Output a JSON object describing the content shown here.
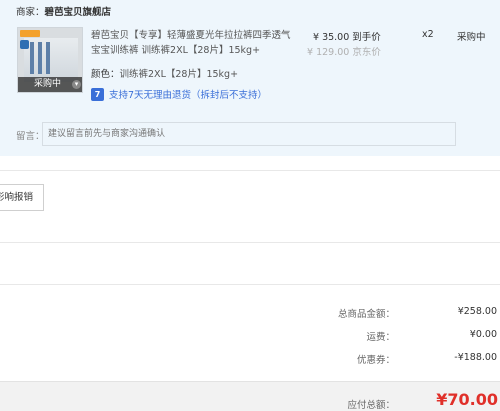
{
  "merchant": {
    "label": "商家：",
    "name": "碧芭宝贝旗舰店"
  },
  "product": {
    "title": "碧芭宝贝【专享】轻薄盛夏光年拉拉裤四季透气宝宝训练裤 训练裤2XL【28片】15kg+",
    "price": "¥ 35.00 到手价",
    "original_price": "¥ 129.00 京东价",
    "quantity": "x2",
    "status": "采购中",
    "image_overlay_label": "采购中",
    "spec_key": "颜色：",
    "spec_value": "训练裤2XL【28片】15kg+",
    "return_policy": "支持7天无理由退货（拆封后不支持）",
    "return_icon": "7"
  },
  "message": {
    "label": "留言：",
    "placeholder": "建议留言前先与商家沟通确认"
  },
  "report_button": "影响报销",
  "summary": {
    "goods_total_label": "总商品金额：",
    "goods_total_value": "¥258.00",
    "shipping_label": "运费：",
    "shipping_value": "¥0.00",
    "discount_label": "优惠券：",
    "discount_value": "-¥188.00"
  },
  "total": {
    "label": "应付总额：",
    "value": "¥70.00"
  },
  "colors": {
    "accent_blue": "#3a6fd8",
    "total_red": "#e0302a",
    "panel_bg": "#eef6fc"
  }
}
